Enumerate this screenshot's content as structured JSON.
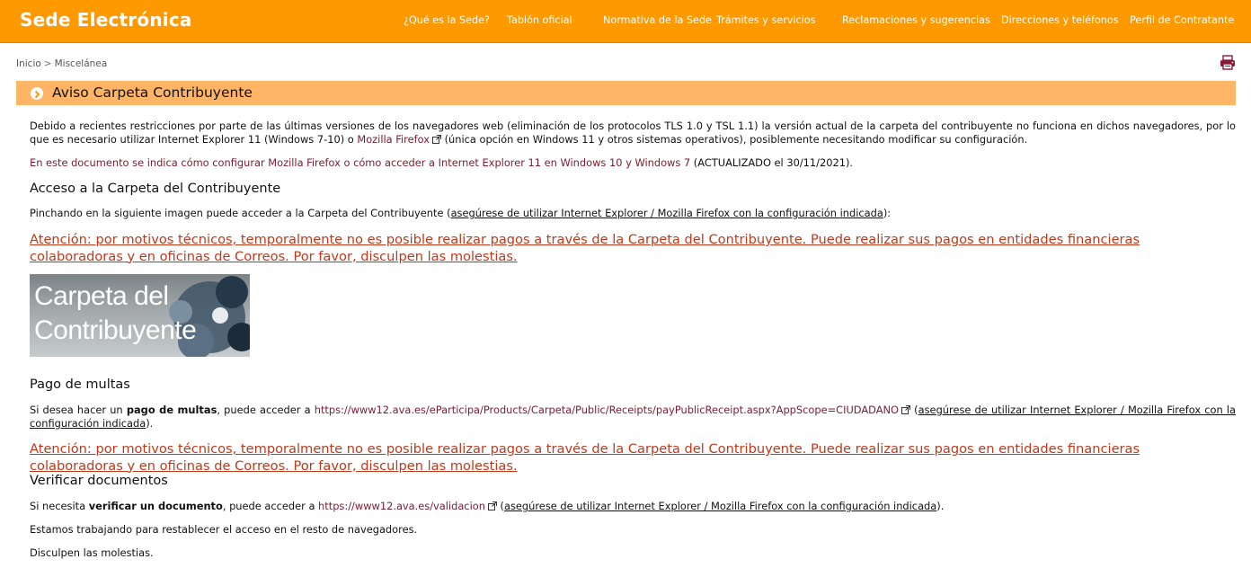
{
  "header": {
    "brand": "Sede Electrónica",
    "nav": [
      "¿Qué es la Sede?",
      "Tablón oficial",
      "Normativa de la Sede",
      "Trámites y servicios",
      "Reclamaciones y sugerencias",
      "Direcciones y teléfonos",
      "Perfil de Contratante"
    ]
  },
  "breadcrumb": {
    "home": "Inicio",
    "separator": ">",
    "current": "Miscelánea"
  },
  "print_icon": "printer-icon",
  "page_title": "Aviso Carpeta Contribuyente",
  "intro": {
    "text1": "Debido a recientes restricciones por parte de las últimas versiones de los navegadores web (eliminación de los protocolos TLS 1.0 y TSL 1.1) la versión actual de la carpeta del contribuyente no funciona en dichos navegadores, por lo que es necesario utilizar Internet Explorer 11 (Windows 7-10) o ",
    "firefox_link": "Mozilla Firefox",
    "text2": " (única opción en Windows 11 y otros sistemas operativos), posiblemente necesitando modificar su configuración."
  },
  "config_note": {
    "link": "En este documento se indica cómo configurar Mozilla Firefox o cómo acceder a Internet Explorer 11 en Windows 10 y Windows 7",
    "suffix": " (ACTUALIZADO el 30/11/2021)."
  },
  "acceso": {
    "heading": "Acceso a la Carpeta del Contribuyente",
    "text": "Pinchando en la siguiente imagen puede acceder a la Carpeta del Contribuyente (",
    "link": "asegúrese de utilizar Internet Explorer / Mozilla Firefox con la configuración indicada",
    "end": "):"
  },
  "alert_text": "Atención: por motivos técnicos, temporalmente no es posible realizar pagos a través de la Carpeta del Contribuyente. Puede realizar sus pagos en entidades financieras colaboradoras y en oficinas de Correos. Por favor, disculpen las molestias.",
  "banner": {
    "line1": "Carpeta del",
    "line2": "Contribuyente"
  },
  "multas": {
    "heading": "Pago de multas",
    "pre": "Si desea hacer un ",
    "bold": "pago de multas",
    "mid": ", puede acceder a ",
    "url": "https://www12.ava.es/eParticipa/Products/Carpeta/Public/Receipts/payPublicReceipt.aspx?AppScope=CIUDADANO",
    "paren_open": " (",
    "link": "asegúrese de utilizar Internet Explorer / Mozilla Firefox con la configuración indicada",
    "end": ")."
  },
  "verificar": {
    "heading": "Verificar documentos",
    "pre": "Si necesita ",
    "bold": "verificar un documento",
    "mid": ", puede acceder a ",
    "url": "https://www12.ava.es/validacion",
    "paren_open": " (",
    "link": "asegúrese de utilizar Internet Explorer / Mozilla Firefox con la configuración indicada",
    "end": ")."
  },
  "working_note": "Estamos trabajando para restablecer el acceso en el resto de navegadores.",
  "apology": "Disculpen las molestias.",
  "colors": {
    "header": "#ff9900",
    "title_bar": "#ffb466",
    "alert": "#c0391b",
    "link": "#7a1c2e"
  }
}
